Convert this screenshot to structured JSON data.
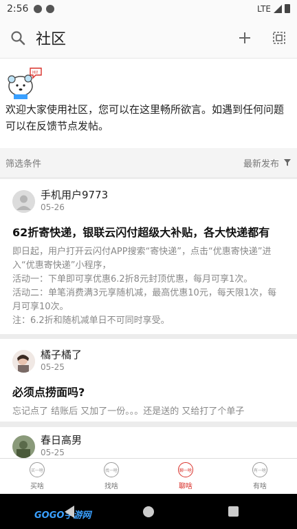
{
  "status": {
    "time": "2:56",
    "network": "LTE"
  },
  "header": {
    "title": "社区"
  },
  "intro": {
    "mascot_text": "HI!",
    "text": "欢迎大家使用社区，您可以在这里畅所欲言。如遇到任何问题可以在反馈节点发帖。"
  },
  "filter": {
    "label": "筛选条件",
    "sort": "最新发布"
  },
  "posts": [
    {
      "user": "手机用户9773",
      "date": "05-26",
      "title": "62折寄快递，银联云闪付超级大补贴，各大快递都有",
      "body": "即日起，用户打开云闪付APP搜索“寄快递”，点击“优惠寄快递”进入“优惠寄快递”小程序，\n活动一：下单即可享优惠6.2折8元封顶优惠，每月可享1次。\n活动二：单笔消费满3元享随机减，最高优惠10元，每天限1次，每月可享10次。\n注：6.2折和随机减单日不可同时享受。"
    },
    {
      "user": "橘子橘了",
      "date": "05-25",
      "title": "必须点捞面吗?",
      "body": "忘记点了 结账后 又加了一份。。。还是送的 又给打了个单子"
    },
    {
      "user": "春日高男",
      "date": "05-25"
    }
  ],
  "tabs": [
    {
      "label": "买啥",
      "icon_text": "买一啥"
    },
    {
      "label": "找啥",
      "icon_text": "找一啥"
    },
    {
      "label": "聊啥",
      "icon_text": "聊一啥"
    },
    {
      "label": "有啥",
      "icon_text": "有一啥"
    }
  ],
  "watermark": "GOGO手游网",
  "colors": {
    "accent": "#d9302a"
  }
}
